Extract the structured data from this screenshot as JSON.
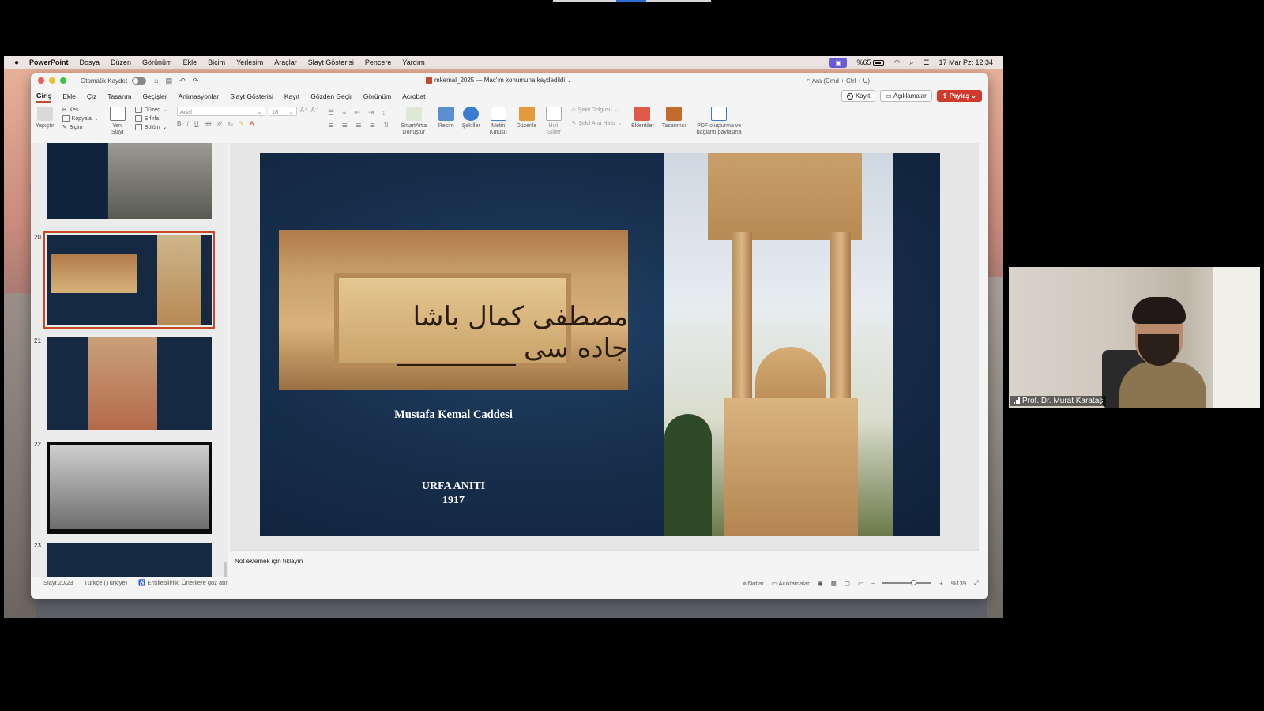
{
  "menubar": {
    "app_name": "PowerPoint",
    "items": [
      "Dosya",
      "Düzen",
      "Görünüm",
      "Ekle",
      "Biçim",
      "Yerleşim",
      "Araçlar",
      "Slayt Gösterisi",
      "Pencere",
      "Yardım"
    ],
    "battery": "%65",
    "datetime": "17 Mar Pzt  12:34"
  },
  "window": {
    "autosave_label": "Otomatik Kaydet",
    "doc_title": "mkemal_2025 — Mac'im konumuna kaydedildi",
    "search_placeholder": "Ara (Cmd + Ctrl + U)"
  },
  "tabs": [
    "Giriş",
    "Ekle",
    "Çiz",
    "Tasarım",
    "Geçişler",
    "Animasyonlar",
    "Slayt Gösterisi",
    "Kayıt",
    "Gözden Geçir",
    "Görünüm",
    "Acrobat"
  ],
  "actions": {
    "record": "Kayıt",
    "comments": "Açıklamalar",
    "share": "Paylaş"
  },
  "ribbon": {
    "paste": "Yapıştır",
    "cut": "Kes",
    "copy": "Kopyala",
    "format": "Biçim",
    "new_slide": "Yeni Slayt",
    "layout": "Düzen",
    "reset": "Sıfırla",
    "section": "Bölüm",
    "font_name": "Arial",
    "font_size": "18",
    "smartart": "SmartArt'a Dönüştür",
    "picture": "Resim",
    "shapes": "Şekiller",
    "textbox": "Metin Kutusu",
    "arrange": "Düzenle",
    "quick_styles": "Hızlı Stiller",
    "shape_fill": "Şekil Dolgusu",
    "shape_outline": "Şekil Ana Hattı",
    "addins": "Eklentiler",
    "designer": "Tasarımcı",
    "pdf": "PDF oluşturma ve bağlantı paylaşma"
  },
  "thumbnails": {
    "numbers": [
      "20",
      "21",
      "22",
      "23"
    ],
    "selected": "20"
  },
  "slide": {
    "arabic_text": "مصطفى كمال باشا جاده سى",
    "title": "Mustafa Kemal Caddesi",
    "caption_line1": "URFA ANITI",
    "caption_line2": "1917"
  },
  "notes_placeholder": "Not eklemek için tıklayın",
  "status": {
    "slide_pos": "Slayt 20/23",
    "language": "Türkçe (Türkiye)",
    "accessibility": "Erişilebilirlik: Önerilere göz atın",
    "notes": "Notlar",
    "comments": "Açıklamalar",
    "zoom": "%139"
  },
  "zoom_fraction": 0.58,
  "webcam": {
    "name": "Prof. Dr. Murat Karataş"
  },
  "colors": {
    "accent": "#c64826",
    "share": "#d03a2c",
    "slide_bg": "#172f4d",
    "cast": "#6a5bd6"
  }
}
